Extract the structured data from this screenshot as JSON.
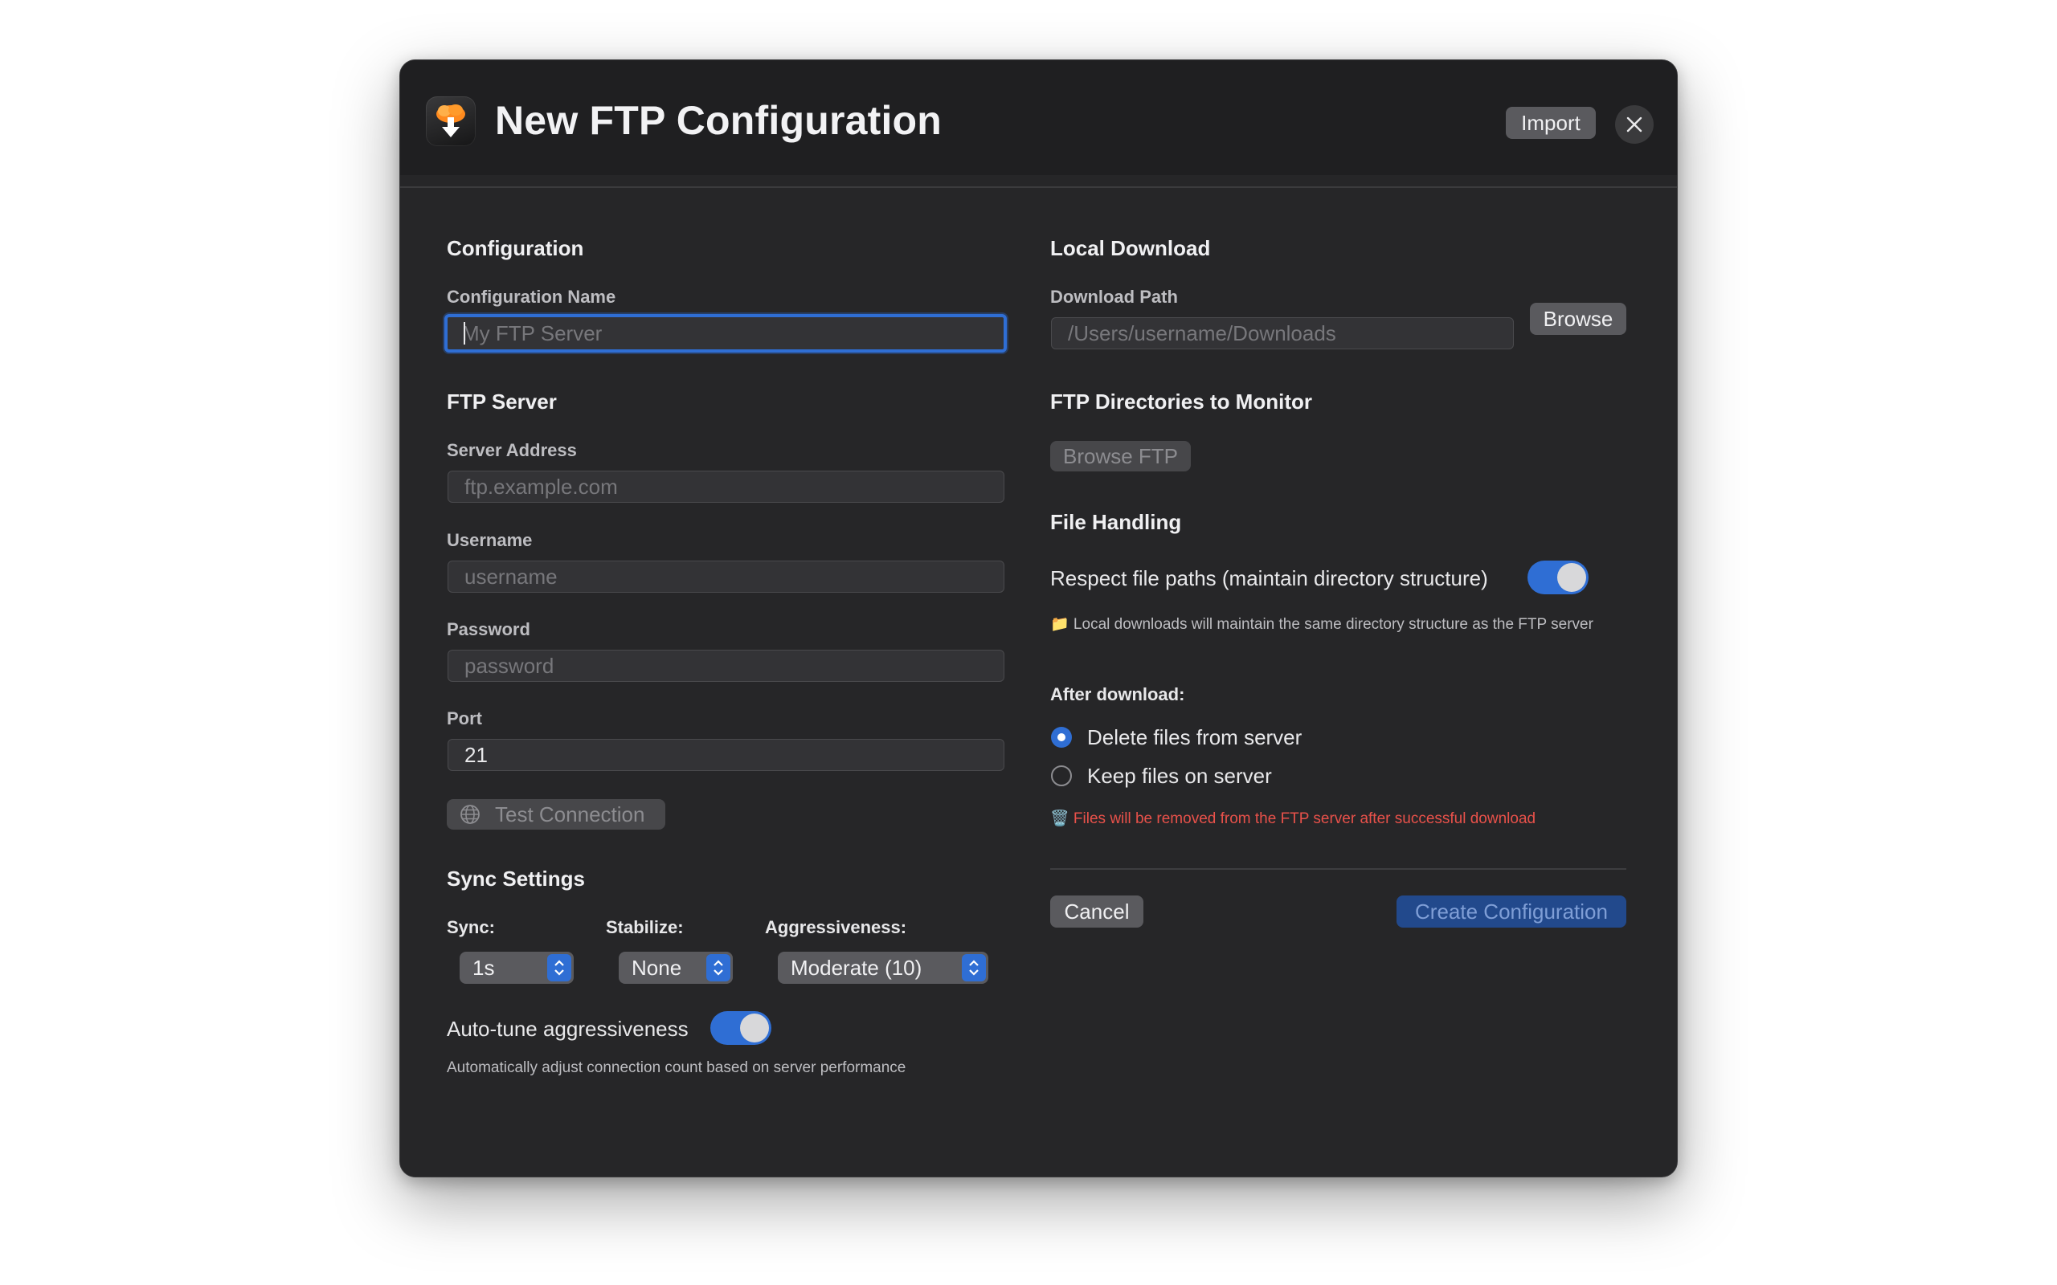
{
  "window": {
    "title": "New FTP Configuration",
    "import_label": "Import"
  },
  "configuration": {
    "section_title": "Configuration",
    "name_label": "Configuration Name",
    "name_placeholder": "My FTP Server",
    "name_value": ""
  },
  "ftp_server": {
    "section_title": "FTP Server",
    "address_label": "Server Address",
    "address_placeholder": "ftp.example.com",
    "username_label": "Username",
    "username_placeholder": "username",
    "password_label": "Password",
    "password_placeholder": "password",
    "port_label": "Port",
    "port_value": "21",
    "test_connection_label": "Test Connection"
  },
  "sync_settings": {
    "section_title": "Sync Settings",
    "sync_label": "Sync:",
    "sync_value": "1s",
    "stabilize_label": "Stabilize:",
    "stabilize_value": "None",
    "aggressiveness_label": "Aggressiveness:",
    "aggressiveness_value": "Moderate (10)",
    "autotune_label": "Auto-tune aggressiveness",
    "autotune_enabled": true,
    "autotune_help": "Automatically adjust connection count based on server performance"
  },
  "local_download": {
    "section_title": "Local Download",
    "path_label": "Download Path",
    "path_placeholder": "/Users/username/Downloads",
    "browse_label": "Browse"
  },
  "ftp_directories": {
    "section_title": "FTP Directories to Monitor",
    "browse_ftp_label": "Browse FTP"
  },
  "file_handling": {
    "section_title": "File Handling",
    "respect_paths_label": "Respect file paths (maintain directory structure)",
    "respect_paths_enabled": true,
    "respect_paths_help": "📁 Local downloads will maintain the same directory structure as the FTP server",
    "after_download_label": "After download:",
    "options": [
      {
        "label": "Delete files from server",
        "selected": true
      },
      {
        "label": "Keep files on server",
        "selected": false
      }
    ],
    "delete_warning": "🗑️ Files will be removed from the FTP server after successful download"
  },
  "footer": {
    "cancel_label": "Cancel",
    "create_label": "Create Configuration"
  },
  "colors": {
    "accent": "#2f6ed4",
    "warning": "#e8514a",
    "window_bg": "#262628"
  }
}
